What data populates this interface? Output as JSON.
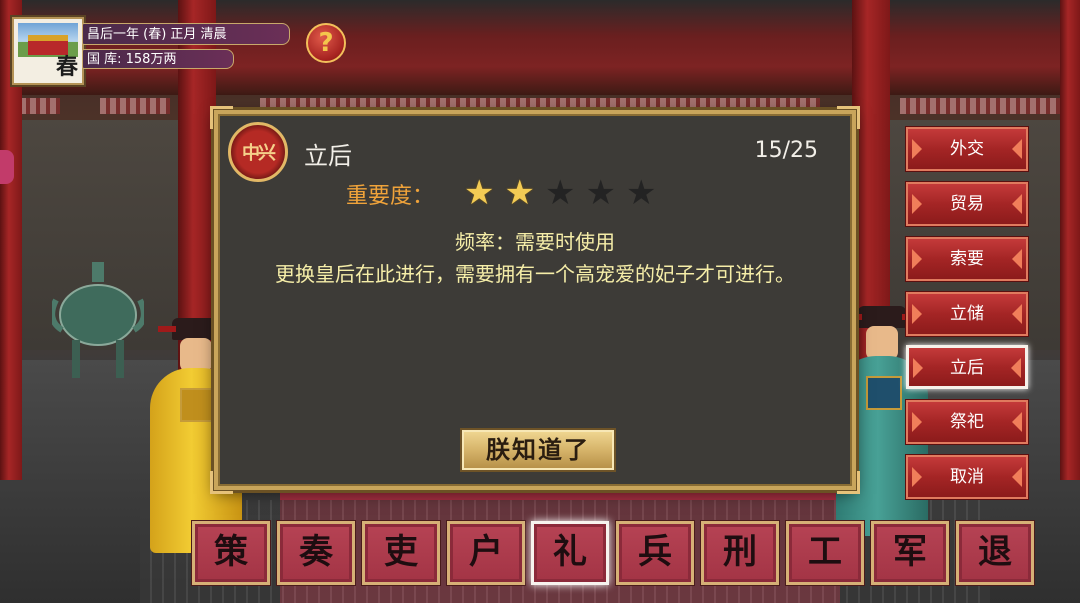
{
  "hud": {
    "season_char": "春",
    "date": "昌后一年 (春) 正月 清晨",
    "treasury": "国 库: 158万两",
    "help_symbol": "?"
  },
  "dialog": {
    "emblem_text": "中兴",
    "title": "立后",
    "counter": "15/25",
    "importance_label": "重要度：",
    "importance_stars": 2,
    "importance_max": 5,
    "frequency": "频率：需要时使用",
    "description": "更换皇后在此进行，需要拥有一个高宠爱的妃子才可进行。",
    "confirm_button": "朕知道了"
  },
  "right_menu": {
    "items": [
      {
        "label": "外交"
      },
      {
        "label": "贸易"
      },
      {
        "label": "索要"
      },
      {
        "label": "立储"
      },
      {
        "label": "立后"
      },
      {
        "label": "祭祀"
      },
      {
        "label": "取消"
      }
    ],
    "active_index": 4
  },
  "bottom_bar": {
    "items": [
      {
        "label": "策"
      },
      {
        "label": "奏"
      },
      {
        "label": "吏"
      },
      {
        "label": "户"
      },
      {
        "label": "礼"
      },
      {
        "label": "兵"
      },
      {
        "label": "刑"
      },
      {
        "label": "工"
      },
      {
        "label": "军"
      },
      {
        "label": "退"
      }
    ],
    "active_index": 4
  },
  "colors": {
    "accent_gold": "#c9a55b",
    "importance_orange": "#f0a33a",
    "text_cream": "#f6eea8",
    "menu_red": "#a42525"
  }
}
